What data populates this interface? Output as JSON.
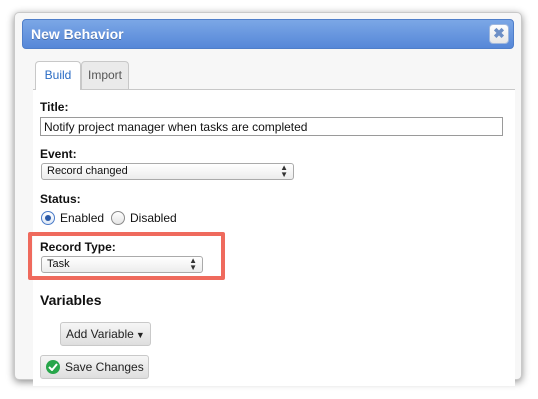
{
  "dialog": {
    "title": "New Behavior",
    "close_icon": "close-icon",
    "close_glyph": "✖"
  },
  "tabs": [
    {
      "label": "Build",
      "active": true
    },
    {
      "label": "Import",
      "active": false
    }
  ],
  "form": {
    "title_label": "Title:",
    "title_value": "Notify project manager when tasks are completed",
    "event_label": "Event:",
    "event_value": "Record changed",
    "status_label": "Status:",
    "status_options": [
      {
        "label": "Enabled",
        "checked": true
      },
      {
        "label": "Disabled",
        "checked": false
      }
    ],
    "record_type_label": "Record Type:",
    "record_type_value": "Task",
    "variables_heading": "Variables",
    "add_variable_label": "Add Variable",
    "save_label": "Save Changes"
  },
  "colors": {
    "titlebar": "#5f8fdc",
    "highlight_border": "#ef6a5d",
    "save_icon": "#27a64a",
    "active_tab_text": "#2a6cc4"
  }
}
